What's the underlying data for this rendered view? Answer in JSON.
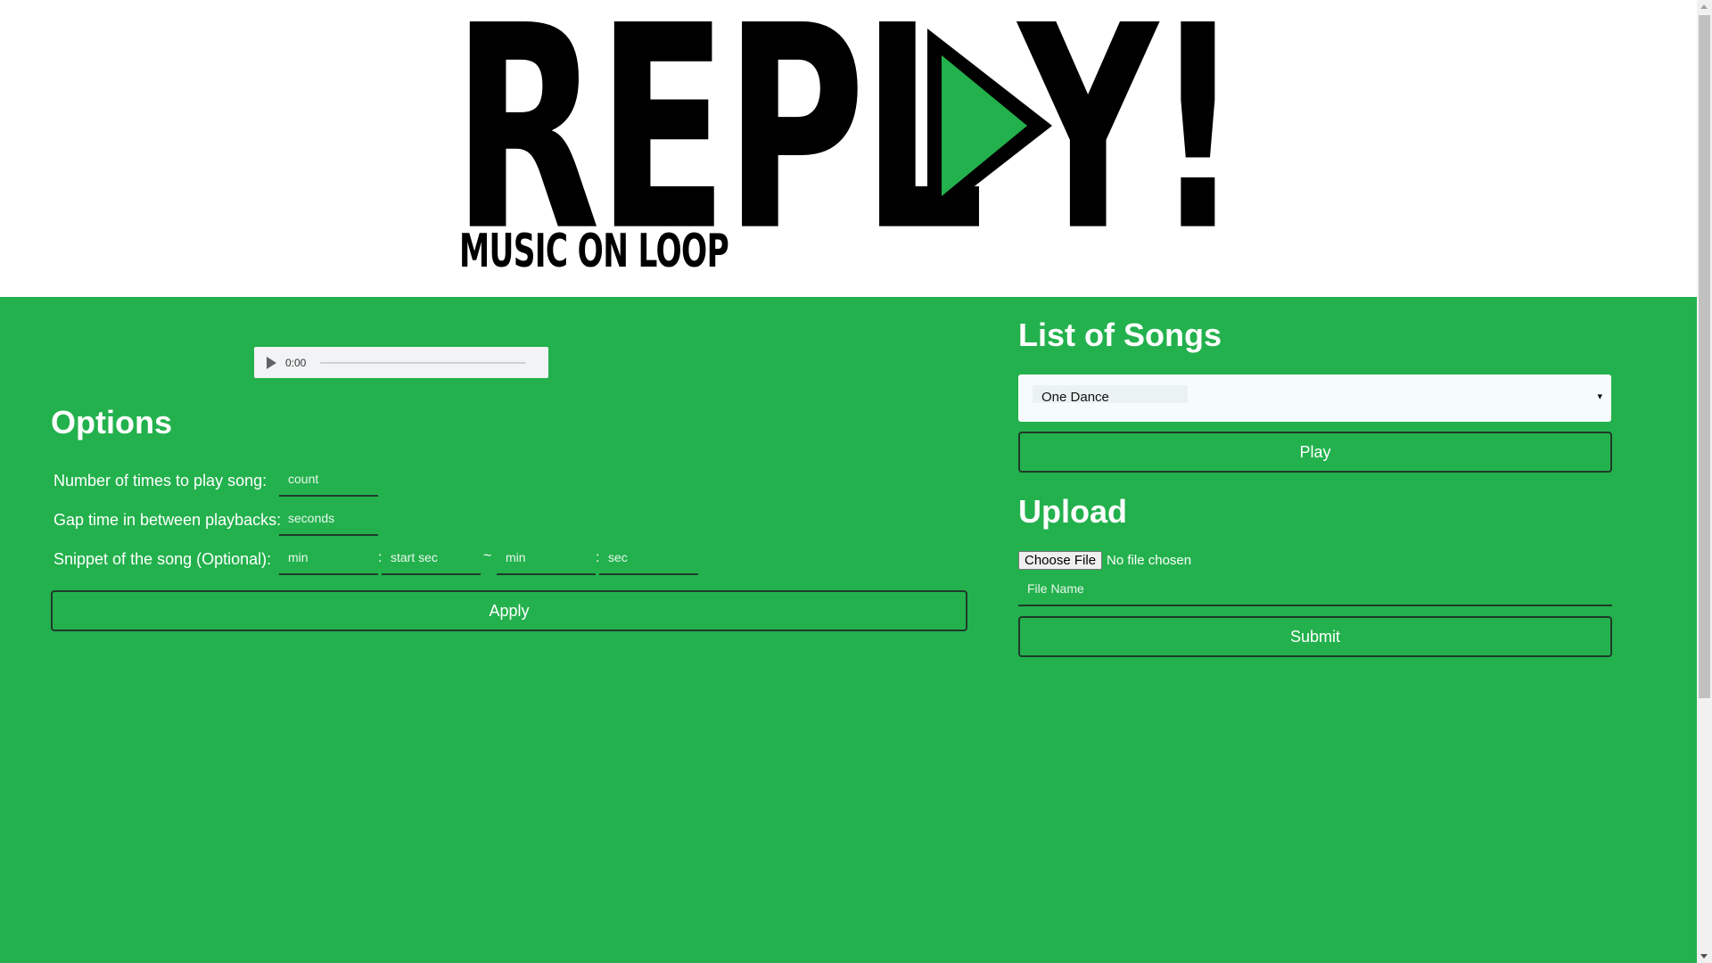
{
  "logo": {
    "text_part1": "REPL",
    "text_part2": "Y!",
    "tagline": "MUSIC ON LOOP",
    "play_icon": "play-triangle-icon",
    "colors": {
      "text": "#000000",
      "triangle": "#23b14d"
    }
  },
  "player": {
    "time": "0:00",
    "play_icon": "play-icon"
  },
  "options": {
    "heading": "Options",
    "count_label": "Number of times to play song:",
    "count_placeholder": "count",
    "gap_label": "Gap time in between playbacks:",
    "gap_placeholder": "seconds",
    "snippet_label": "Snippet of the song (Optional):",
    "start_min_placeholder": "min",
    "start_sec_placeholder": "start sec",
    "end_min_placeholder": "min",
    "end_sec_placeholder": "sec",
    "colon": ":",
    "tilde": "~",
    "apply_label": "Apply"
  },
  "songs": {
    "heading": "List of Songs",
    "selected": "One Dance",
    "dropdown_arrow": "▾",
    "play_label": "Play"
  },
  "upload": {
    "heading": "Upload",
    "choose_file_label": "Choose File",
    "file_status": "No file chosen",
    "file_name_placeholder": "File Name",
    "submit_label": "Submit"
  },
  "colors": {
    "background_green": "#23b14d",
    "border_dark": "#1f3a2a",
    "text_white": "#ffffff"
  }
}
